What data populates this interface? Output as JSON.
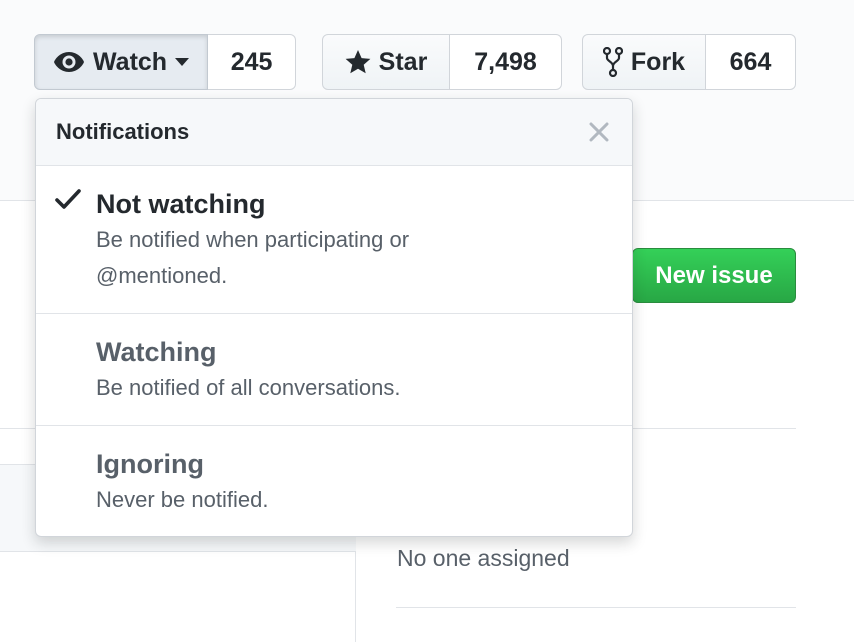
{
  "watch": {
    "label": "Watch",
    "count": "245",
    "icon": "eye-icon",
    "caret_icon": "caret-down-icon"
  },
  "star": {
    "label": "Star",
    "count": "7,498",
    "icon": "star-icon"
  },
  "fork": {
    "label": "Fork",
    "count": "664",
    "icon": "repo-forked-icon"
  },
  "new_issue_label": "New issue",
  "assignees_text": "No one assigned",
  "dropdown": {
    "title": "Notifications",
    "close_icon": "close-icon",
    "items": [
      {
        "title": "Not watching",
        "desc_line1": "Be notified when participating or",
        "desc_line2": "@mentioned.",
        "selected": true
      },
      {
        "title": "Watching",
        "desc_line1": "Be notified of all conversations.",
        "selected": false
      },
      {
        "title": "Ignoring",
        "desc_line1": "Never be notified.",
        "selected": false
      }
    ]
  },
  "colors": {
    "accent_green": "#28a745",
    "text": "#24292e",
    "muted": "#586069",
    "border": "#e1e4e8"
  }
}
